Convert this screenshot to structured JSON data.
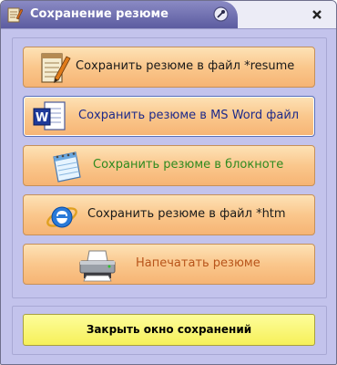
{
  "window": {
    "title": "Сохранение резюме",
    "close_glyph": "×"
  },
  "buttons": [
    {
      "label": "Сохранить резюме в файл *resume",
      "icon": "notepad-pencil-icon",
      "color": "#1a1a1a"
    },
    {
      "label": "Сохранить резюме в MS Word файл",
      "icon": "word-document-icon",
      "color": "#1e2a8a"
    },
    {
      "label": "Сохранить резюме в блокноте",
      "icon": "notebook-icon",
      "color": "#2f8a1f"
    },
    {
      "label": "Сохранить резюме в файл *htm",
      "icon": "internet-explorer-icon",
      "color": "#1a1a1a"
    },
    {
      "label": "Напечатать резюме",
      "icon": "printer-icon",
      "color": "#b8541a"
    }
  ],
  "footer": {
    "close_label": "Закрыть окно сохранений"
  },
  "colors": {
    "window_bg": "#c3c3ec",
    "title_bar": "#6f6fb0",
    "action_button": "#fac78c",
    "close_button": "#f6f05a"
  }
}
